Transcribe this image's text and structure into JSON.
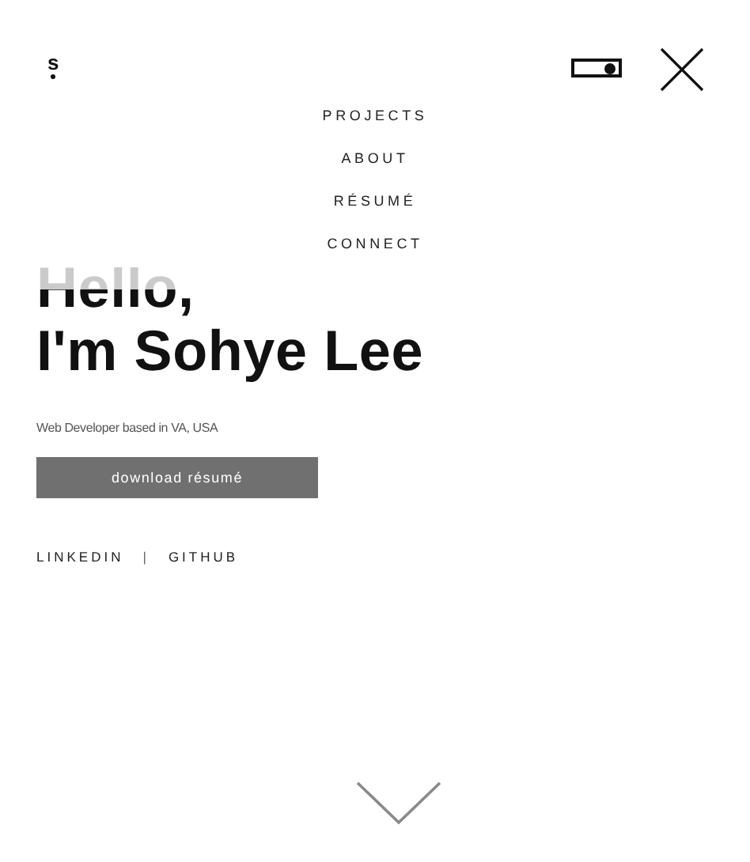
{
  "logo": "s",
  "theme_toggle": {
    "on": true
  },
  "menu": [
    {
      "label": "PROJECTS"
    },
    {
      "label": "ABOUT"
    },
    {
      "label": "RÉSUMÉ"
    },
    {
      "label": "CONNECT"
    }
  ],
  "hero": {
    "greeting": "Hello,",
    "name": "I'm Sohye Lee",
    "tagline": "Web Developer based in VA, USA",
    "button": "download résumé"
  },
  "social_links": [
    "LINKEDIN",
    "GITHUB"
  ],
  "separator": "|"
}
